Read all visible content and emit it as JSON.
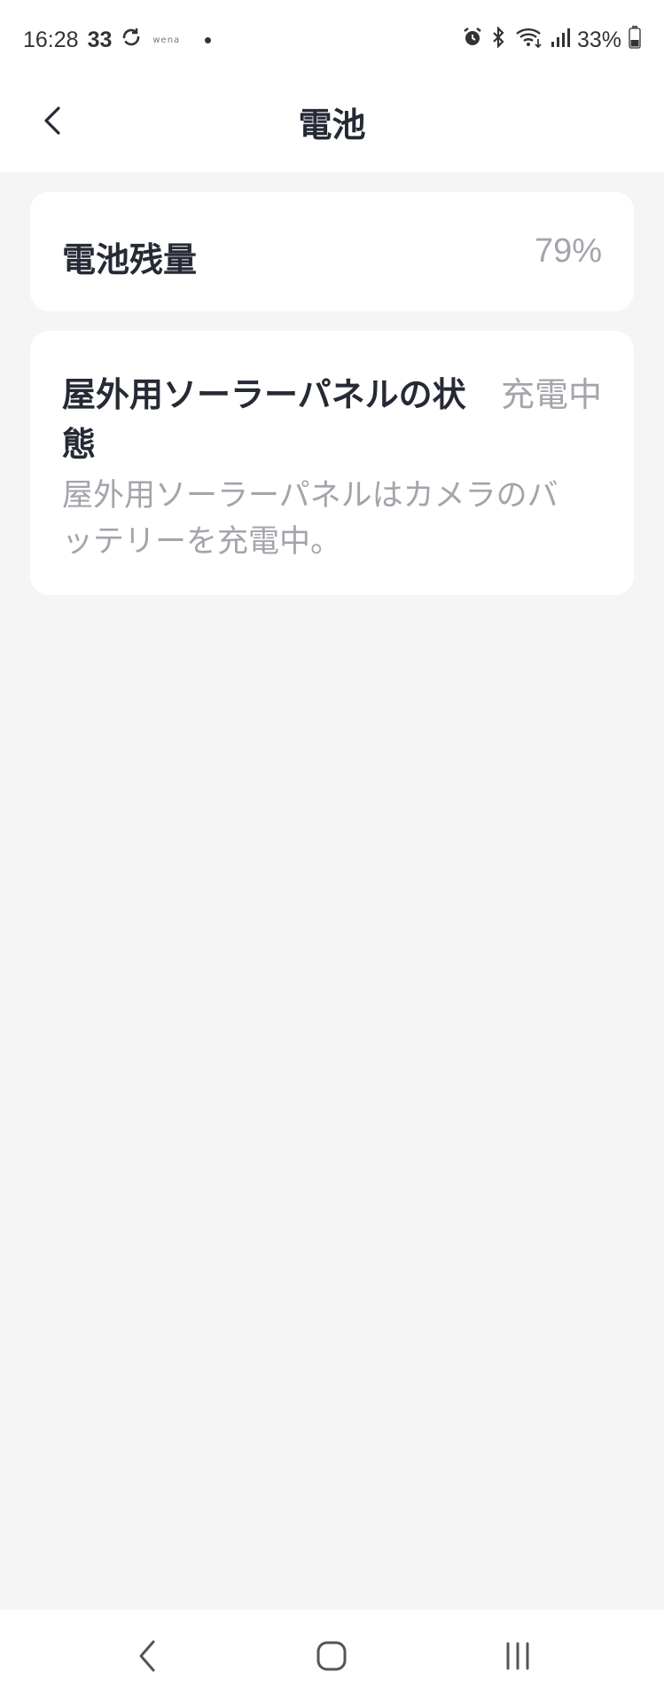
{
  "status_bar": {
    "time": "16:28",
    "number": "33",
    "small_text": "wena",
    "battery_percent": "33%"
  },
  "header": {
    "title": "電池",
    "back_icon": "chevron-left-icon"
  },
  "battery_card": {
    "label": "電池残量",
    "value": "79%"
  },
  "solar_card": {
    "label": "屋外用ソーラーパネルの状態",
    "status": "充電中",
    "description": "屋外用ソーラーパネルはカメラのバッテリーを充電中。"
  },
  "nav_bar": {
    "back_icon": "nav-back-icon",
    "home_icon": "nav-home-icon",
    "recent_icon": "nav-recent-apps-icon"
  },
  "colors": {
    "background": "#f5f5f5",
    "card": "#ffffff",
    "primary_text": "#262a35",
    "secondary_text": "#a3a5ab"
  }
}
